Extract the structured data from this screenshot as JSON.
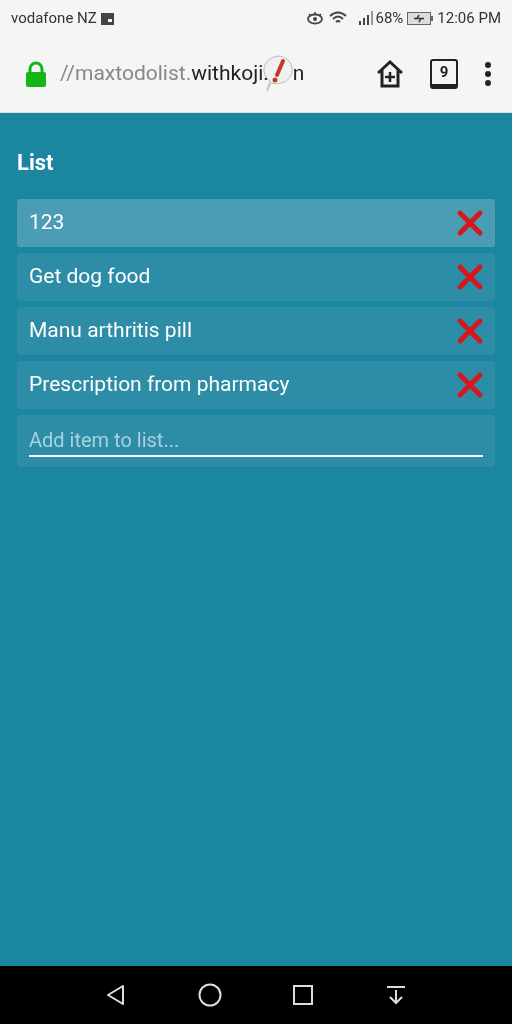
{
  "status_bar": {
    "carrier": "vodafone NZ",
    "battery": "68%",
    "time": "12:06 PM"
  },
  "browser": {
    "url_parts": [
      {
        "text": "//maxtodolist.",
        "dim": true
      },
      {
        "text": "withkoji.",
        "dim": false
      }
    ],
    "url_tail": "n",
    "tab_count": "9"
  },
  "list": {
    "title": "List",
    "items": [
      {
        "text": "123",
        "selected": true
      },
      {
        "text": "Get dog food",
        "selected": false
      },
      {
        "text": "Manu arthritis pill",
        "selected": false
      },
      {
        "text": "Prescription from pharmacy",
        "selected": false
      }
    ],
    "add_field": {
      "placeholder": "Add item to list..."
    }
  }
}
